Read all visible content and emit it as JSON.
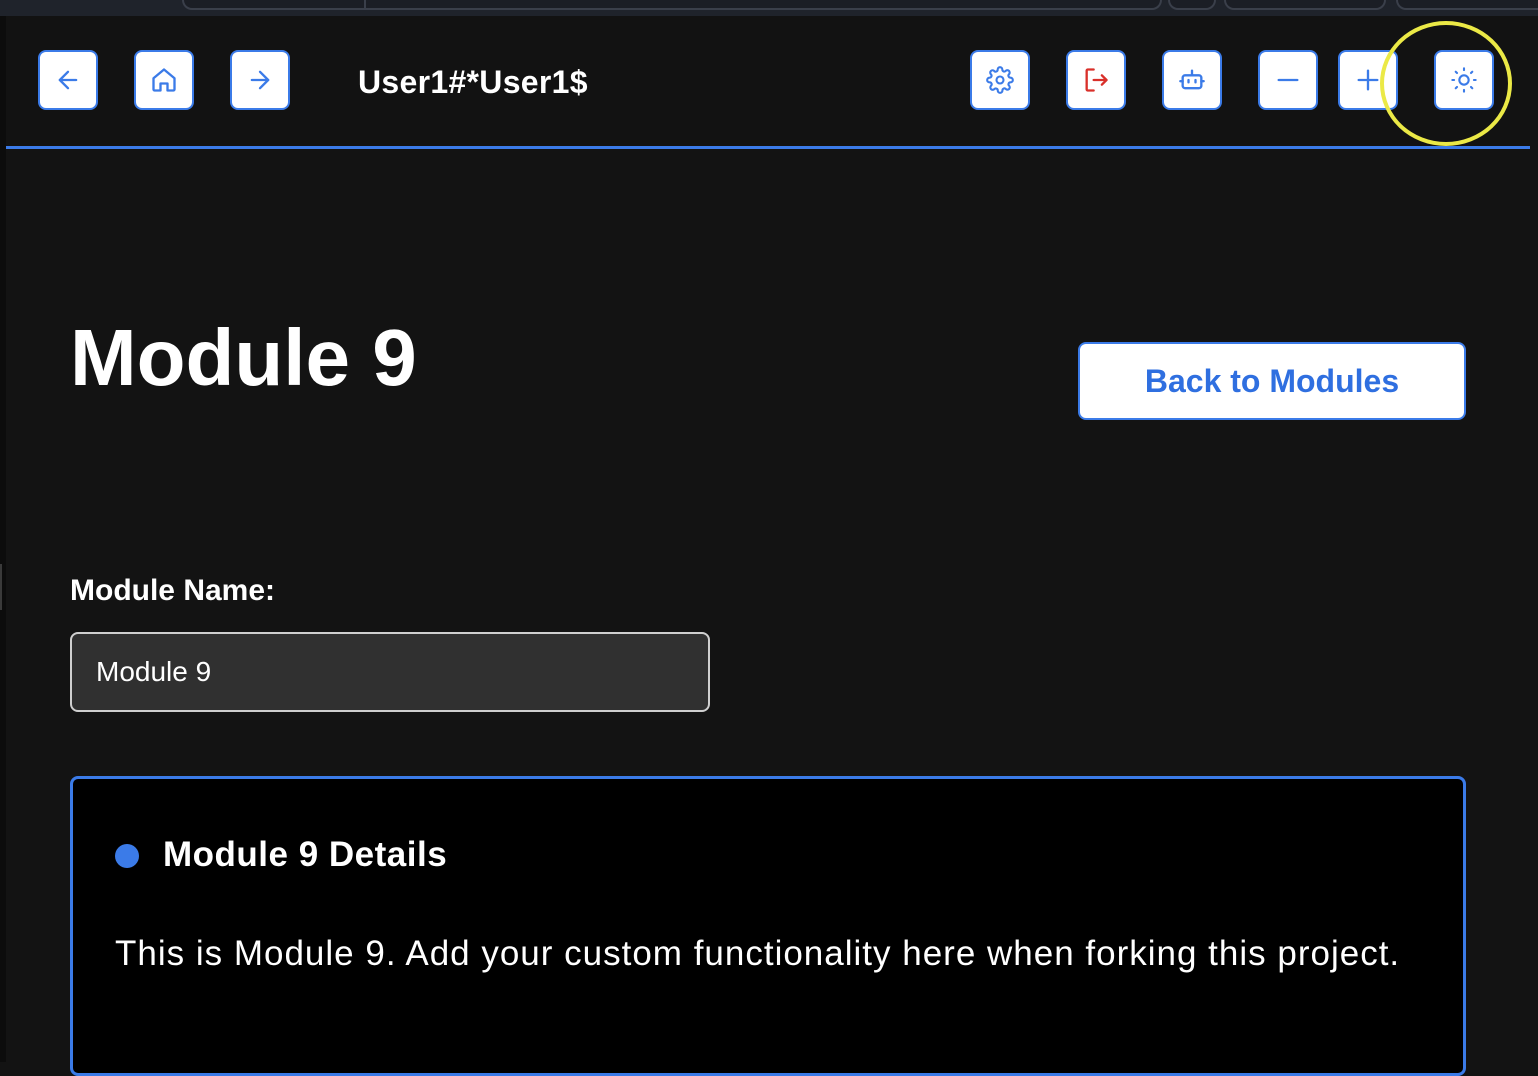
{
  "header": {
    "user_label": "User1#*User1$",
    "buttons": {
      "back": "arrow-left-icon",
      "home": "home-icon",
      "forward": "arrow-right-icon",
      "settings": "gear-icon",
      "logout": "logout-icon",
      "assistant": "bot-icon",
      "zoom_out": "minus-icon",
      "zoom_in": "plus-icon",
      "theme": "sun-icon"
    }
  },
  "page": {
    "title": "Module 9",
    "back_button_label": "Back to Modules"
  },
  "form": {
    "name_label": "Module Name:",
    "name_value": "Module 9"
  },
  "details": {
    "heading": "Module 9 Details",
    "body": "This is Module 9. Add your custom functionality here when forking this project."
  },
  "colors": {
    "accent": "#3b7be8",
    "logout_icon": "#d9302a",
    "background": "#131313",
    "highlight": "#ebe946"
  }
}
